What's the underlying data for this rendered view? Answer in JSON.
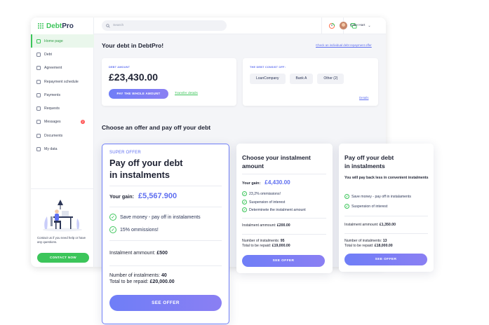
{
  "app": {
    "logo_part1": "Debt",
    "logo_part2": "Pro"
  },
  "search": {
    "placeholder": "Search"
  },
  "user": {
    "name": "Katie Hart"
  },
  "sidebar": {
    "items": [
      {
        "label": "Home page",
        "active": true,
        "icon": "home-icon"
      },
      {
        "label": "Debt",
        "icon": "debt-icon"
      },
      {
        "label": "Agreement",
        "icon": "agreement-icon"
      },
      {
        "label": "Repayment schedule",
        "icon": "calendar-icon"
      },
      {
        "label": "Payments",
        "icon": "card-icon"
      },
      {
        "label": "Requests",
        "icon": "requests-icon"
      },
      {
        "label": "Messages",
        "icon": "mail-icon",
        "badge": "2"
      },
      {
        "label": "Documents",
        "icon": "document-icon"
      },
      {
        "label": "My data",
        "icon": "gear-icon"
      }
    ],
    "contact_text": "Contact us if you need help or have any questions.",
    "contact_button": "CONTACT NOW"
  },
  "header": {
    "title": "Your debt in DebtPro!",
    "check_link": "Check an individual debt repayment offer"
  },
  "debt_amount": {
    "label": "DEBT AMOUNT",
    "value": "£23,430.00",
    "pay_button": "PAY THE WHOLE AMOUNT",
    "transfer_link": "Transfer details"
  },
  "debt_consist": {
    "label": "THE DEBT CONSIST OFF:",
    "chips": [
      "LoanCompany",
      "Bank A",
      "Other (2)"
    ],
    "details_link": "Details"
  },
  "offers_section": {
    "title": "Choose an offer and pay off your debt"
  },
  "offer_main": {
    "tag": "SUPER OFFER",
    "title_line1": "Pay off your debt",
    "title_line2": "in instalments",
    "gain_label": "Your gain:",
    "gain_value": "£5,567.900",
    "features": [
      "Save money - pay off in instalaments",
      "15% ommissions!"
    ],
    "instalment_label": "Instalment ammount:",
    "instalment_value": "£500",
    "number_label": "Number of instalments:",
    "number_value": "40",
    "total_label": "Total to be repaid:",
    "total_value": "£20,000.00",
    "button": "SEE OFFER"
  },
  "offer_2": {
    "title_line1": "Choose your instalment",
    "title_line2": "amount",
    "gain_label": "Your gain:",
    "gain_value": "£4,430.00",
    "features": [
      "23,2% ommissions!",
      "Suspension of interest",
      "Determinete the instalment amount"
    ],
    "instalment_label": "Instalment ammount:",
    "instalment_value": "£200.00",
    "number_label": "Number of instalments:",
    "number_value": "95",
    "total_label": "Total to be repaid:",
    "total_value": "£19,000.00",
    "button": "SEE OFFER"
  },
  "offer_3": {
    "title_line1": "Pay off your debt",
    "title_line2": "in instalments",
    "description": "You will pay back less in convenient instalments",
    "features": [
      "Save money - pay off in instalaments",
      "Suspension of interest"
    ],
    "instalment_label": "Instalment ammount:",
    "instalment_value": "£1,350.00",
    "number_label": "Number of instalments:",
    "number_value": "13",
    "total_label": "Total to be repaid:",
    "total_value": "£18,000.00",
    "button": "SEE OFFER"
  },
  "colors": {
    "accent": "#5f6ff0",
    "brand_green": "#3cc55a",
    "badge_red": "#ff5a5a"
  }
}
